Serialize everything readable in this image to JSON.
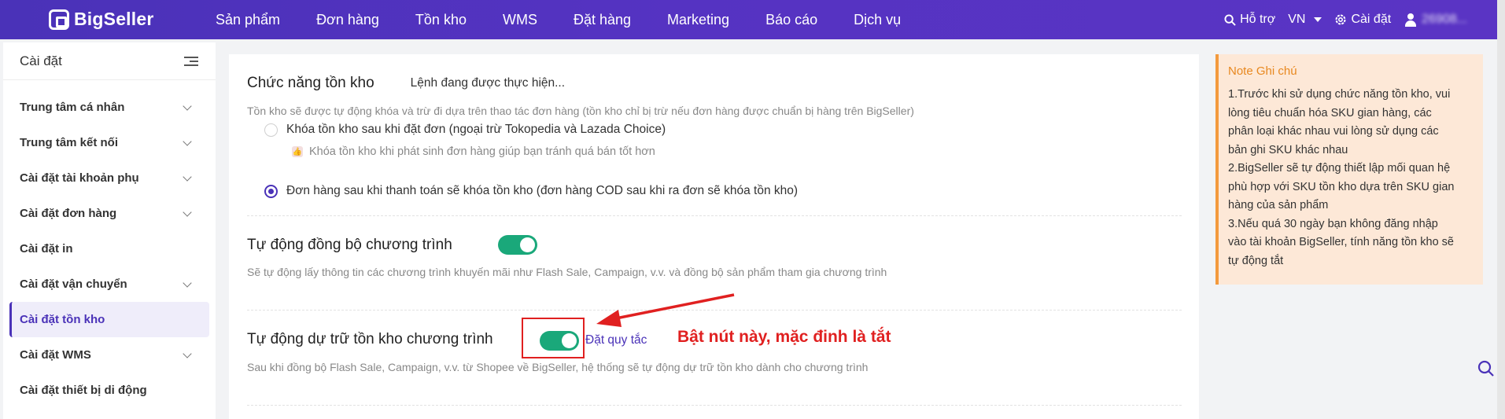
{
  "topbar": {
    "logo_text": "BigSeller",
    "nav": [
      "Sản phẩm",
      "Đơn hàng",
      "Tồn kho",
      "WMS",
      "Đặt hàng",
      "Marketing",
      "Báo cáo",
      "Dịch vụ"
    ],
    "help_label": "Hỗ trợ",
    "language": "VN",
    "settings_label": "Cài đặt",
    "user_name": "26908..."
  },
  "sidebar": {
    "title": "Cài đặt",
    "items": [
      {
        "label": "Trung tâm cá nhân",
        "chevron": true
      },
      {
        "label": "Trung tâm kết nối",
        "chevron": true
      },
      {
        "label": "Cài đặt tài khoản phụ",
        "chevron": true
      },
      {
        "label": "Cài đặt đơn hàng",
        "chevron": true
      },
      {
        "label": "Cài đặt in",
        "chevron": false
      },
      {
        "label": "Cài đặt vận chuyển",
        "chevron": true
      },
      {
        "label": "Cài đặt tồn kho",
        "chevron": false,
        "active": true
      },
      {
        "label": "Cài đặt WMS",
        "chevron": true
      },
      {
        "label": "Cài đặt thiết bị di động",
        "chevron": false
      }
    ]
  },
  "main": {
    "inventory": {
      "title": "Chức năng tồn kho",
      "status": "Lệnh đang được thực hiện...",
      "description": "Tồn kho sẽ được tự động khóa và trừ đi dựa trên thao tác đơn hàng (tồn kho chỉ bị trừ nếu đơn hàng được chuẩn bị hàng trên BigSeller)",
      "option1": "Khóa tồn kho sau khi đặt đơn (ngoại trừ Tokopedia và Lazada Choice)",
      "option1_tip": "Khóa tồn kho khi phát sinh đơn hàng giúp bạn tránh quá bán tốt hơn",
      "option2": "Đơn hàng sau khi thanh toán sẽ khóa tồn kho (đơn hàng COD sau khi ra đơn sẽ khóa tồn kho)",
      "selected_option": 2
    },
    "sync": {
      "title": "Tự động đồng bộ chương trình",
      "enabled": true,
      "description": "Sẽ tự động lấy thông tin các chương trình khuyến mãi như Flash Sale, Campaign, v.v. và đồng bộ sản phẩm tham gia chương trình"
    },
    "reserve": {
      "title": "Tự động dự trữ tồn kho chương trình",
      "enabled": true,
      "rule_link": "Đặt quy tắc",
      "description": "Sau khi đồng bộ Flash Sale, Campaign, v.v. từ Shopee về BigSeller, hệ thống sẽ tự động dự trữ tồn kho dành cho chương trình"
    }
  },
  "annotation": {
    "text": "Bật nút này, mặc đinh là tắt",
    "color": "#e02020"
  },
  "note": {
    "title": "Note Ghi chú",
    "lines": [
      "1.Trước khi sử dụng chức năng tồn kho, vui",
      "lòng tiêu chuẩn hóa SKU gian hàng, các",
      "phân loại khác nhau vui lòng sử dụng các",
      "bản ghi SKU khác nhau",
      "2.BigSeller sẽ tự động thiết lập mối quan hệ",
      "phù hợp với SKU tồn kho dựa trên SKU gian",
      "hàng của sản phẩm",
      "3.Nếu quá 30 ngày bạn không đăng nhập",
      "vào tài khoản BigSeller, tính năng tồn kho sẽ",
      "tự động tắt"
    ]
  },
  "colors": {
    "brand": "#4a32b8",
    "toggle_on": "#1aa87a",
    "note_bg": "#fde8d7",
    "note_accent": "#f39a3d"
  }
}
